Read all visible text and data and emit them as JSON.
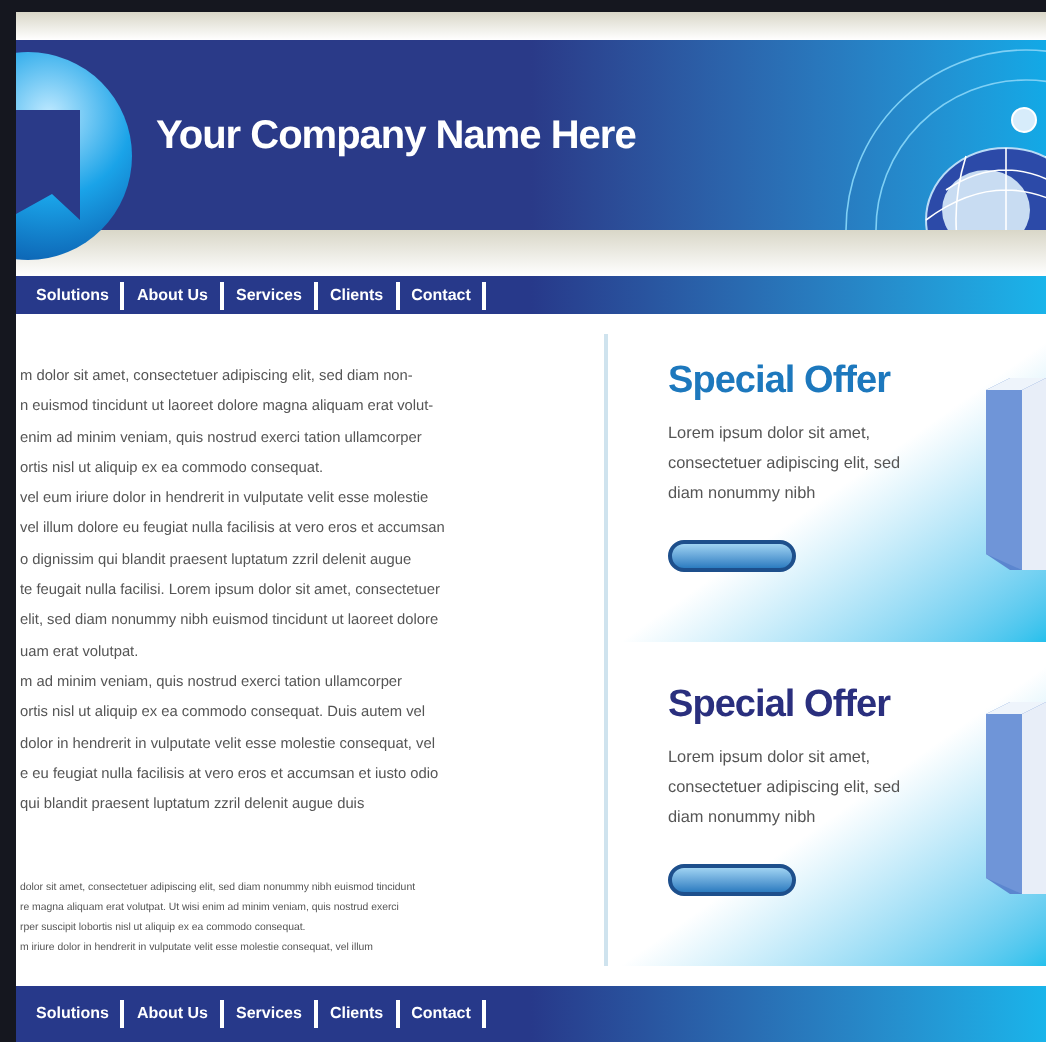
{
  "header": {
    "company_name": "Your Company Name Here"
  },
  "nav": [
    "Solutions",
    "About Us",
    "Services",
    "Clients",
    "Contact"
  ],
  "body_text": {
    "lines": [
      "m dolor sit amet, consectetuer adipiscing elit, sed diam non-",
      "n euismod tincidunt ut laoreet dolore magna aliquam erat volut-",
      "enim ad minim veniam, quis nostrud exerci tation ullamcorper",
      "ortis nisl ut aliquip ex ea commodo consequat.",
      "vel eum iriure dolor in hendrerit in vulputate velit esse molestie",
      "vel illum dolore eu feugiat nulla facilisis at vero eros et accumsan",
      "o dignissim qui blandit praesent luptatum zzril delenit augue",
      "te feugait nulla facilisi. Lorem ipsum dolor sit amet, consectetuer",
      "elit, sed diam nonummy nibh euismod tincidunt ut laoreet dolore",
      "uam erat volutpat.",
      "m ad minim veniam, quis nostrud exerci tation ullamcorper",
      "ortis nisl ut aliquip ex ea commodo consequat. Duis autem vel",
      "dolor in hendrerit in vulputate velit esse molestie consequat, vel",
      "e eu feugiat nulla facilisis at vero eros et accumsan et iusto odio",
      "qui blandit praesent luptatum zzril delenit augue duis"
    ],
    "small_lines": [
      "dolor sit amet, consectetuer adipiscing elit, sed diam nonummy nibh euismod tincidunt",
      "re magna aliquam erat volutpat. Ut wisi enim ad minim veniam, quis nostrud exerci",
      "rper suscipit lobortis nisl ut aliquip ex ea commodo consequat.",
      "m iriure dolor in hendrerit in vulputate velit esse molestie consequat, vel illum"
    ]
  },
  "offers": [
    {
      "title": "Special Offer",
      "text": "Lorem ipsum dolor sit amet, consectetuer adipiscing elit, sed diam nonummy nibh",
      "color": "#1d78bd"
    },
    {
      "title": "Special Offer",
      "text": "Lorem ipsum dolor sit amet, consectetuer adipiscing elit, sed diam nonummy nibh",
      "color": "#2a2f7e"
    }
  ],
  "footer_nav": [
    "Solutions",
    "About Us",
    "Services",
    "Clients",
    "Contact"
  ]
}
